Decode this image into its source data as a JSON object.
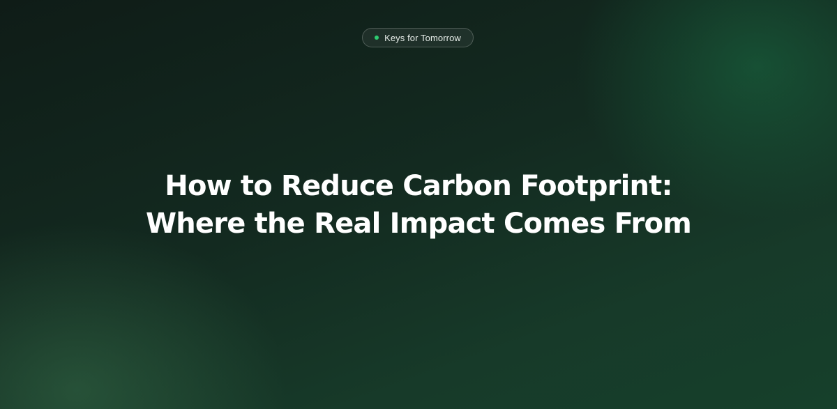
{
  "badge": {
    "label": "Keys for Tomorrow",
    "dot_color": "#2ecc71"
  },
  "hero": {
    "title_line_1": "How to Reduce Carbon Footprint:",
    "title_line_2": "Where the Real Impact Comes From"
  },
  "colors": {
    "background_dark": "#0f1c17",
    "background_green": "#16402b",
    "accent": "#2ecc71",
    "title_text": "#ffffff"
  }
}
